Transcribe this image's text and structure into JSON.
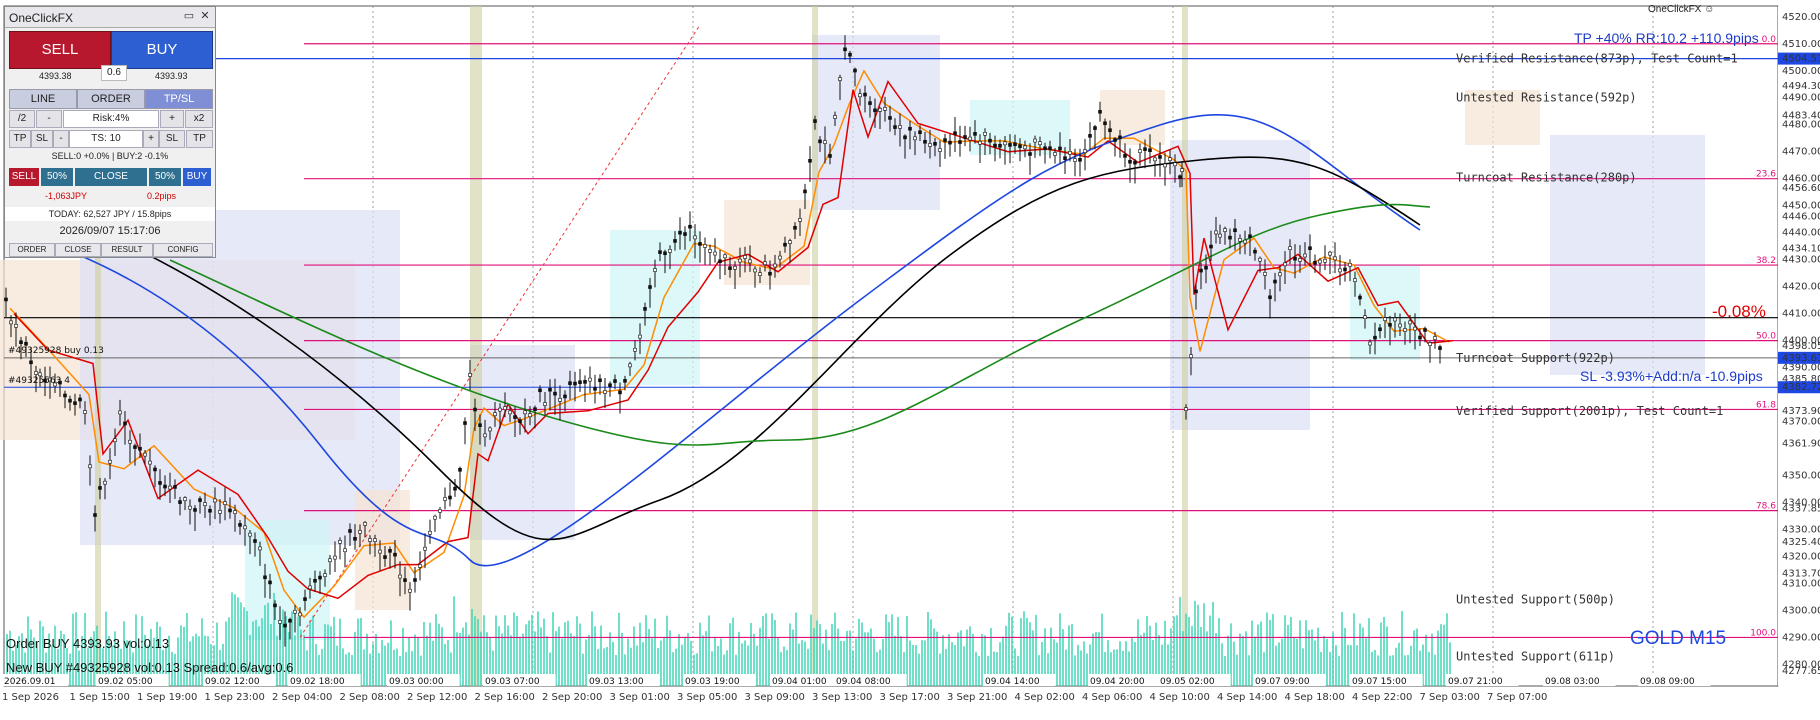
{
  "window": {
    "title": "OneClickFX",
    "brand": "OneClickFX"
  },
  "panel": {
    "sell_label": "SELL",
    "buy_label": "BUY",
    "sell_price": "4393.38",
    "buy_price": "4393.93",
    "spread": "0.6",
    "tabs": [
      "LINE",
      "ORDER",
      "TP/SL"
    ],
    "half": "/2",
    "minus": "-",
    "risk": "Risk:4%",
    "plus": "+",
    "double": "x2",
    "tp": "TP",
    "sl": "SL",
    "ts_minus": "-",
    "ts": "TS: 10",
    "ts_plus": "+",
    "positions": "SELL:0 +0.0% | BUY:2 -0.1%",
    "close_row": [
      "SELL",
      "50%",
      "CLOSE",
      "50%",
      "BUY"
    ],
    "pl_jpy": "-1,063JPY",
    "pl_pips": "0.2pips",
    "today": "TODAY: 62,527 JPY / 15.8pips",
    "clock": "2026/09/07  15:17:06",
    "footer": [
      "ORDER",
      "CLOSE",
      "RESULT",
      "CONFIG"
    ]
  },
  "chart": {
    "symbol": "GOLD M15",
    "order_line1": "Order BUY 4393.93 vol:0.13",
    "order_line2": "New BUY #49325928 vol:0.13 Spread:0.6/avg:0.6",
    "pnl_pct": "-0.08%",
    "tp_label": "TP +40% RR:10.2 +110.9pips",
    "sl_label": "SL -3.93%+Add:n/a -10.9pips",
    "position_tag": "#49325928 buy 0.13",
    "position_tag2": "#49325563 4",
    "colors": {
      "red": "#e00000",
      "blue": "#1d47e0",
      "magenta": "#e0107a",
      "green": "#1a8a1a",
      "bull_candle": "#111111"
    }
  },
  "levels": [
    {
      "label": "Verified Resistance(873p), Test Count=1",
      "price": 4504.51
    },
    {
      "label": "Untested Resistance(592p)",
      "price": 4490.0
    },
    {
      "label": "Turncoat Resistance(280p)",
      "price": 4460.5
    },
    {
      "label": "Turncoat Support(922p)",
      "price": 4393.61
    },
    {
      "label": "Verified Support(2001p), Test Count=1",
      "price": 4373.9
    },
    {
      "label": "Untested Support(500p)",
      "price": 4304.0
    },
    {
      "label": "Untested Support(611p)",
      "price": 4283.0
    }
  ],
  "fib": [
    {
      "pct": "0.0",
      "price": 4510.0
    },
    {
      "pct": "23.6",
      "price": 4460.0
    },
    {
      "pct": "38.2",
      "price": 4428.0
    },
    {
      "pct": "50.0",
      "price": 4400.0
    },
    {
      "pct": "61.8",
      "price": 4374.5
    },
    {
      "pct": "78.6",
      "price": 4337.0
    },
    {
      "pct": "100.0",
      "price": 4290.0
    }
  ],
  "price_axis": [
    "4520.00",
    "4510.00",
    "4500.00",
    "4494.30",
    "4490.00",
    "4483.40",
    "4480.00",
    "4470.00",
    "4460.00",
    "4456.60",
    "4450.00",
    "4446.00",
    "4440.00",
    "4434.10",
    "4430.00",
    "4420.00",
    "4410.00",
    "4400.00",
    "4398.05",
    "4390.00",
    "4385.80",
    "4373.90",
    "4370.00",
    "4361.90",
    "4350.00",
    "4340.00",
    "4337.85",
    "4330.00",
    "4325.40",
    "4320.00",
    "4313.70",
    "4310.00",
    "4300.00",
    "4290.00",
    "4280.00",
    "4277.65"
  ],
  "price_tags": [
    {
      "text": "4504.51",
      "price": 4504.51,
      "color": "#1d47e0"
    },
    {
      "text": "4393.61",
      "price": 4393.61,
      "color": "#1d47e0"
    },
    {
      "text": "4382.72",
      "price": 4382.72,
      "color": "#1d47e0"
    }
  ],
  "time_axis": [
    "1 Sep 2026",
    "1 Sep 15:00",
    "1 Sep 19:00",
    "1 Sep 23:00",
    "2 Sep 04:00",
    "2 Sep 08:00",
    "2 Sep 12:00",
    "2 Sep 16:00",
    "2 Sep 20:00",
    "3 Sep 01:00",
    "3 Sep 05:00",
    "3 Sep 09:00",
    "3 Sep 13:00",
    "3 Sep 17:00",
    "3 Sep 21:00",
    "4 Sep 02:00",
    "4 Sep 06:00",
    "4 Sep 10:00",
    "4 Sep 14:00",
    "4 Sep 18:00",
    "4 Sep 22:00",
    "7 Sep 03:00",
    "7 Sep 07:00"
  ],
  "session_labels": [
    "2026.09.01",
    "09.02 05:00",
    "09.02 12:00",
    "09.02 18:00",
    "09.03 00:00",
    "09.03 07:00",
    "09.03 13:00",
    "09.03 19:00",
    "09.04 01:00",
    "09.04 08:00",
    "09.04 14:00",
    "09.04 20:00",
    "09.05 02:00",
    "09.07 09:00",
    "09.07 15:00",
    "09.07 21:00",
    "09.08 03:00",
    "09.08 09:00"
  ]
}
